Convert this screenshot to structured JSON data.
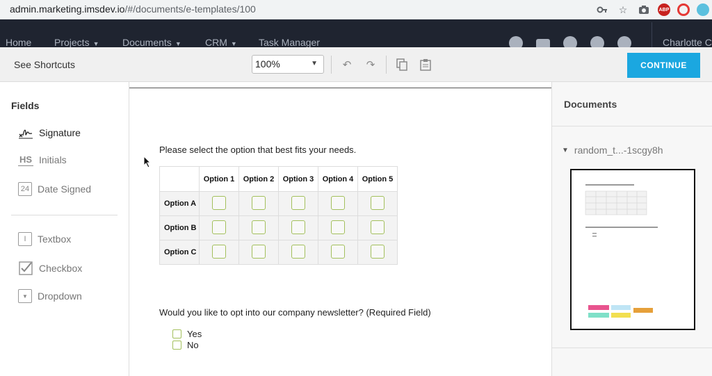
{
  "browser": {
    "url_host": "admin.marketing.imsdev.io",
    "url_path": "/#/documents/e-templates/100"
  },
  "nav": {
    "home": "Home",
    "projects": "Projects",
    "documents": "Documents",
    "crm": "CRM",
    "task_manager": "Task Manager",
    "user": "Charlotte C"
  },
  "toolbar": {
    "shortcuts": "See Shortcuts",
    "zoom": "100%",
    "continue": "CONTINUE"
  },
  "fields": {
    "title": "Fields",
    "items": [
      {
        "label": "Signature",
        "icon": "signature-icon"
      },
      {
        "label": "Initials",
        "icon": "initials-icon"
      },
      {
        "label": "Date Signed",
        "icon": "date-signed-icon"
      },
      {
        "label": "Textbox",
        "icon": "textbox-icon"
      },
      {
        "label": "Checkbox",
        "icon": "checkbox-icon"
      },
      {
        "label": "Dropdown",
        "icon": "dropdown-icon"
      }
    ]
  },
  "canvas": {
    "question1": "Please select the option that best fits your needs.",
    "columns": [
      "Option 1",
      "Option 2",
      "Option 3",
      "Option 4",
      "Option 5"
    ],
    "rows": [
      "Option A",
      "Option B",
      "Option C"
    ],
    "question2": "Would you like to opt into our company newsletter? (Required Field)",
    "answers": [
      "Yes",
      "No"
    ]
  },
  "documents": {
    "title": "Documents",
    "file": "random_t...-1scgy8h"
  },
  "colors": {
    "accent": "#1ba7e0",
    "nav_bg": "#1f2430",
    "checkbox_border": "#a3c05c"
  }
}
